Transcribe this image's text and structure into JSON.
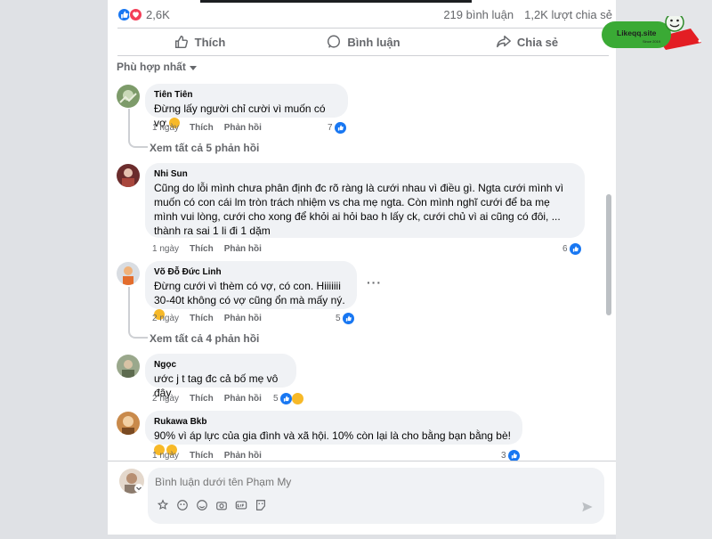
{
  "post": {
    "reaction_count": "2,6K",
    "comment_count": "219 bình luận",
    "share_count": "1,2K lượt chia sẻ",
    "actions": {
      "like": "Thích",
      "comment": "Bình luận",
      "share": "Chia sẻ"
    }
  },
  "sort_label": "Phù hợp nhất",
  "comments": [
    {
      "author": "Tiên Tiên",
      "text": "Đừng lấy người chỉ cười vì muốn có vợ.",
      "time": "1 ngày",
      "like": "Thích",
      "reply": "Phản hồi",
      "reactions": "7",
      "view_more": "Xem tất cả 5 phản hồi"
    },
    {
      "author": "Nhi Sun",
      "text": "Cũng do lỗi mình chưa phân định đc rõ ràng là cưới nhau vì điều gì. Ngta cưới mình vì muốn có con cái lm tròn trách nhiệm vs cha mẹ ngta. Còn mình nghĩ cưới để ba mẹ mình vui lòng, cưới cho xong để khỏi ai hỏi bao h lấy ck, cưới chủ vì ai cũng có đôi, ... thành ra sai 1 li đi 1 dặm",
      "time": "1 ngày",
      "like": "Thích",
      "reply": "Phản hồi",
      "reactions": "6"
    },
    {
      "author": "Võ Đỗ Đức Linh",
      "text": "Đừng cưới vì thèm có vợ, có con. Hiiiiiii 30-40t không có vợ cũng ổn mà mấy ný.",
      "time": "2 ngày",
      "like": "Thích",
      "reply": "Phản hồi",
      "reactions": "5",
      "view_more": "Xem tất cả 4 phản hồi"
    },
    {
      "author": "Ngọc",
      "text": "ước j t tag đc cả bố mẹ vô đây",
      "time": "2 ngày",
      "like": "Thích",
      "reply": "Phản hồi",
      "reactions": "5"
    },
    {
      "author": "Rukawa Bkb",
      "text": "90% vì áp lực của gia đình và xã hội. 10% còn lại là cho bằng bạn bằng bè!",
      "time": "1 ngày",
      "like": "Thích",
      "reply": "Phản hồi",
      "reactions": "3"
    }
  ],
  "composer": {
    "placeholder": "Bình luận dưới tên Phạm My"
  },
  "watermark": {
    "brand": "Likeqq.site",
    "sub": "Since 2019"
  },
  "colors": {
    "like_blue": "#1877f2",
    "love_red": "#f33e58",
    "bubble_bg": "#f0f2f5",
    "watermark_green": "#3aaa35",
    "watermark_red": "#e31e24"
  }
}
